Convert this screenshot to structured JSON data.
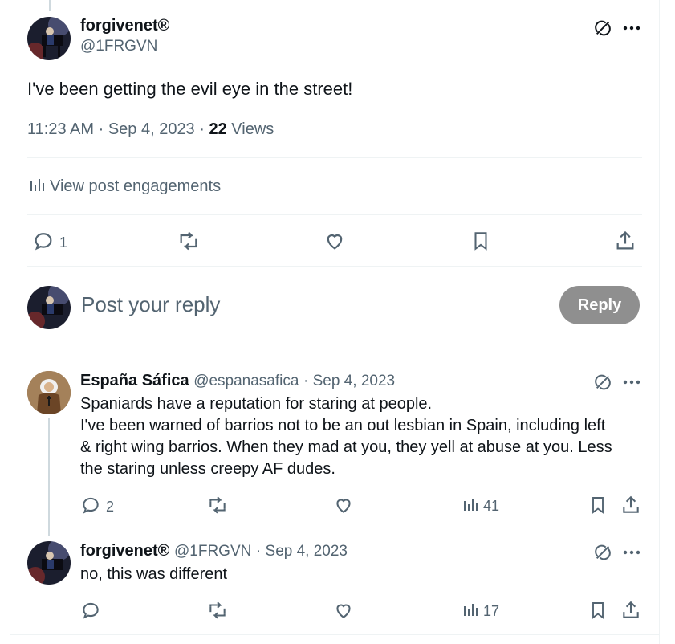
{
  "main_post": {
    "display_name": "forgivenet®",
    "handle": "@1FRGVN",
    "text": "I've been getting the evil eye in the street!",
    "time": "11:23 AM",
    "date": "Sep 4, 2023",
    "views_count": "22",
    "views_label": "Views",
    "engagements_label": "View post engagements",
    "reply_count": "1"
  },
  "composer": {
    "placeholder": "Post your reply",
    "button_label": "Reply"
  },
  "replies": [
    {
      "display_name": "España Sáfica",
      "handle": "@espanasafica",
      "date": "Sep 4, 2023",
      "lines": [
        "Spaniards have a reputation for staring at people.",
        "I've been warned of barrios not to be an out lesbian in Spain, including left",
        "& right wing barrios. When they mad at you, they yell at abuse at you.  Less",
        "the staring unless creepy AF dudes."
      ],
      "reply_count": "2",
      "views": "41"
    },
    {
      "display_name": "forgivenet®",
      "handle": "@1FRGVN",
      "date": "Sep 4, 2023",
      "lines": [
        "no, this was different"
      ],
      "views": "17"
    }
  ],
  "colors": {
    "text": "#0f1419",
    "muted": "#536471",
    "divider": "#eff3f4",
    "reply_button_disabled": "#8f8f8f"
  },
  "icons": [
    "grok-icon",
    "more-icon",
    "reply-icon",
    "repost-icon",
    "like-icon",
    "bookmark-icon",
    "share-icon",
    "analytics-icon"
  ]
}
